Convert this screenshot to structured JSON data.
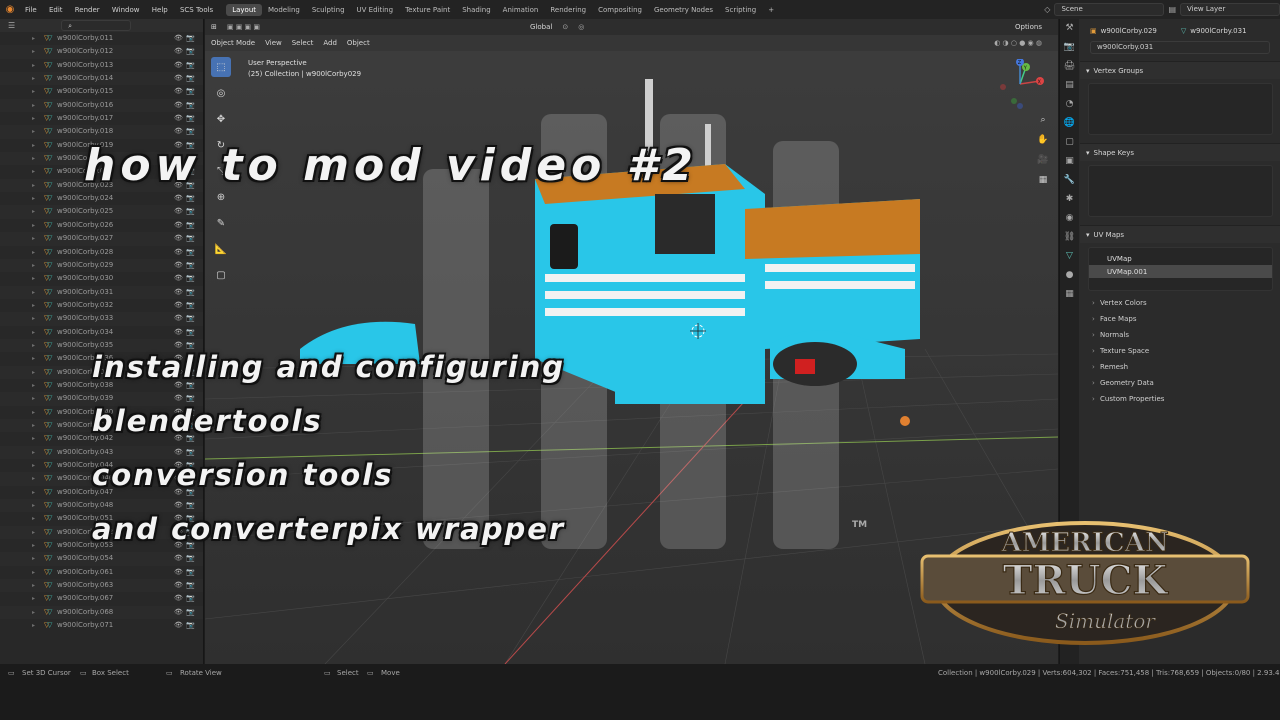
{
  "topbar": {
    "menu": [
      "File",
      "Edit",
      "Render",
      "Window",
      "Help",
      "SCS Tools"
    ],
    "tabs": [
      "Layout",
      "Modeling",
      "Sculpting",
      "UV Editing",
      "Texture Paint",
      "Shading",
      "Animation",
      "Rendering",
      "Compositing",
      "Geometry Nodes",
      "Scripting"
    ],
    "active_tab": "Layout",
    "add_tab": "+",
    "scene": "Scene",
    "view_layer": "View Layer"
  },
  "outliner": {
    "rows": [
      "w900lCorby.011",
      "w900lCorby.012",
      "w900lCorby.013",
      "w900lCorby.014",
      "w900lCorby.015",
      "w900lCorby.016",
      "w900lCorby.017",
      "w900lCorby.018",
      "w900lCorby.019",
      "w900lCorby.020",
      "w900lCorby.021",
      "w900lCorby.023",
      "w900lCorby.024",
      "w900lCorby.025",
      "w900lCorby.026",
      "w900lCorby.027",
      "w900lCorby.028",
      "w900lCorby.029",
      "w900lCorby.030",
      "w900lCorby.031",
      "w900lCorby.032",
      "w900lCorby.033",
      "w900lCorby.034",
      "w900lCorby.035",
      "w900lCorby.036",
      "w900lCorby.037",
      "w900lCorby.038",
      "w900lCorby.039",
      "w900lCorby.040",
      "w900lCorby.041",
      "w900lCorby.042",
      "w900lCorby.043",
      "w900lCorby.044",
      "w900lCorby.046",
      "w900lCorby.047",
      "w900lCorby.048",
      "w900lCorby.051",
      "w900lCorby.052",
      "w900lCorby.053",
      "w900lCorby.054",
      "w900lCorby.061",
      "w900lCorby.063",
      "w900lCorby.067",
      "w900lCorby.068",
      "w900lCorby.071"
    ]
  },
  "viewport": {
    "header": {
      "mode": "Object Mode",
      "view": "View",
      "select": "Select",
      "add": "Add",
      "object": "Object",
      "orientation": "Global",
      "options": "Options"
    },
    "info_line1": "User Perspective",
    "info_line2": "(25) Collection | w900lCorby029",
    "gizmo": {
      "x": "X",
      "y": "Y",
      "z": "Z"
    }
  },
  "overlay": {
    "title": "HOW TO MOD VIDEO #2",
    "line1": "INSTALLING AND CONFIGURING",
    "line2": "BLENDERTOOLS",
    "line3": "CONVERSION TOOLS",
    "line4": "AND CONVERTERPIX WRAPPER"
  },
  "logo": {
    "line1": "AMERICAN",
    "line2": "TRUCK",
    "line3": "Simulator",
    "tm": "TM"
  },
  "properties": {
    "object_name": "w900lCorby.029",
    "mesh_name": "w900lCorby.031",
    "mesh_data_name": "w900lCorby.031",
    "sections": {
      "vertex_groups": "Vertex Groups",
      "shape_keys": "Shape Keys",
      "uv_maps": "UV Maps",
      "vertex_colors": "Vertex Colors",
      "face_maps": "Face Maps",
      "normals": "Normals",
      "texture_space": "Texture Space",
      "remesh": "Remesh",
      "geometry_data": "Geometry Data",
      "custom_properties": "Custom Properties"
    },
    "uv_maps": [
      "UVMap",
      "UVMap.001"
    ]
  },
  "status": {
    "left1": "Set 3D Cursor",
    "left2": "Box Select",
    "left3": "Rotate View",
    "mid1": "Select",
    "mid2": "Move",
    "right": "Collection | w900lCorby.029 | Verts:604,302 | Faces:751,458 | Tris:768,659 | Objects:0/80 | 2.93.4"
  }
}
